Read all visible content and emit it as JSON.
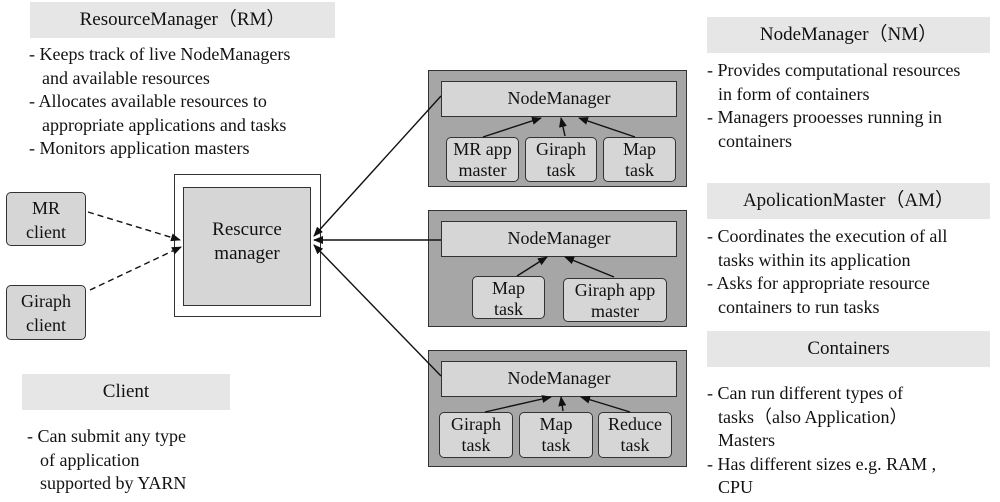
{
  "rm_section": {
    "title": "ResourceManager（RM）",
    "bullets": [
      "- Keeps track of live NodeManagers",
      "and available resources",
      "- Allocates available resources to",
      "appropriate applications and tasks",
      "- Monitors application masters"
    ]
  },
  "client_section": {
    "title": "Client",
    "bullets": [
      "- Can submit any type",
      "of application",
      "supported by YARN"
    ]
  },
  "nm_section": {
    "title": "NodeManager（NM）",
    "bullets": [
      "- Provides computational resources",
      "in form of containers",
      "- Managers prooesses running in",
      "containers"
    ]
  },
  "am_section": {
    "title": "ApolicationMaster（AM）",
    "bullets": [
      "- Coordinates the execution of all",
      "tasks within its application",
      "- Asks for appropriate resource",
      "containers to run tasks"
    ]
  },
  "containers_section": {
    "title": "Containers",
    "bullets": [
      "- Can run different types of",
      "tasks（also Application）",
      "Masters",
      "- Has different sizes e.g. RAM ,",
      "CPU"
    ]
  },
  "diagram": {
    "resource_manager": {
      "line1": "Rescurce",
      "line2": "manager"
    },
    "clients": [
      {
        "line1": "MR",
        "line2": "client"
      },
      {
        "line1": "Giraph",
        "line2": "client"
      }
    ],
    "nodes": [
      {
        "label": "NodeManager",
        "tasks": [
          {
            "line1": "MR app",
            "line2": "master"
          },
          {
            "line1": "Giraph",
            "line2": "task"
          },
          {
            "line1": "Map",
            "line2": "task"
          }
        ]
      },
      {
        "label": "NodeManager",
        "tasks": [
          {
            "line1": "Map",
            "line2": "task"
          },
          {
            "line1": "Giraph app",
            "line2": "master"
          }
        ]
      },
      {
        "label": "NodeManager",
        "tasks": [
          {
            "line1": "Giraph",
            "line2": "task"
          },
          {
            "line1": "Map",
            "line2": "task"
          },
          {
            "line1": "Reduce",
            "line2": "task"
          }
        ]
      }
    ]
  },
  "colors": {
    "header_bg": "#e6e6e6",
    "node_bg": "#a6a6a6",
    "box_bg": "#d6d6d6"
  }
}
